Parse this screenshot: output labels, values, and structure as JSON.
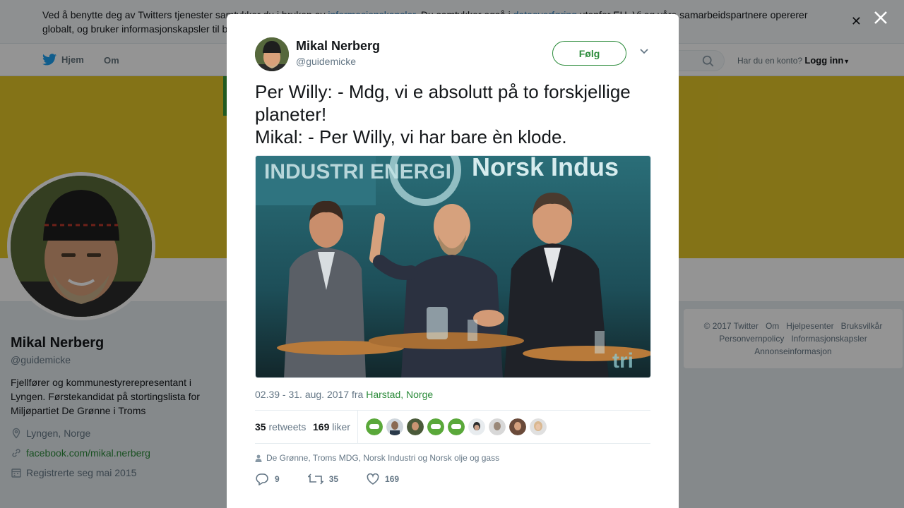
{
  "cookie_bar": {
    "text_before": "Ved å benytte deg av Twitters tjenester samtykker du i bruken av ",
    "link1": "informasjonskapsler",
    "text_middle": ". Du samtykker også i ",
    "link2": "dataoverføring",
    "text_after": " utenfor EU. Vi og våre samarbeidspartnere opererer globalt, og bruker informasjonskapsler til b"
  },
  "nav": {
    "home": "Hjem",
    "about": "Om",
    "account_prompt": "Har du en konto?",
    "login": "Logg inn"
  },
  "profile": {
    "name": "Mikal Nerberg",
    "handle": "@guidemicke",
    "bio": "Fjellfører og kommunestyrerepresentant i Lyngen. Førstekandidat på stortingslista for Miljøpartiet De Grønne i Troms",
    "location": "Lyngen, Norge",
    "website": "facebook.com/mikal.nerberg",
    "joined": "Registrerte seg mai 2015"
  },
  "footer": {
    "links": [
      "© 2017 Twitter",
      "Om",
      "Hjelpesenter",
      "Bruksvilkår",
      "Personvernpolicy",
      "Informasjonskapsler",
      "Annonseinformasjon"
    ]
  },
  "tweet": {
    "author_name": "Mikal Nerberg",
    "author_handle": "@guidemicke",
    "follow_label": "Følg",
    "text": "Per Willy: - Mdg, vi e absolutt på to forskjellige planeter!\nMikal: - Per Willy, vi har bare èn klode.",
    "photo_banner_left": "INDUSTRI ENERGI",
    "photo_banner_right": "Norsk Indus",
    "timestamp": "02.39 - 31. aug. 2017 fra ",
    "place": "Harstad, Norge",
    "retweets_count": "35",
    "retweets_label": "retweets",
    "likes_count": "169",
    "likes_label": "liker",
    "mentions": "De Grønne, Troms MDG, Norsk Industri og Norsk olje og gass",
    "reply_count": "9",
    "retweet_count": "35",
    "like_count": "169"
  },
  "colors": {
    "accent": "#2b8b3a",
    "banner": "#e3c729",
    "text_secondary": "#657786"
  },
  "icons": [
    "twitter-bird-icon",
    "search-icon",
    "caret-down-icon",
    "close-icon",
    "location-icon",
    "link-icon",
    "calendar-icon",
    "chevron-down-icon",
    "person-icon",
    "reply-icon",
    "retweet-icon",
    "heart-icon"
  ]
}
